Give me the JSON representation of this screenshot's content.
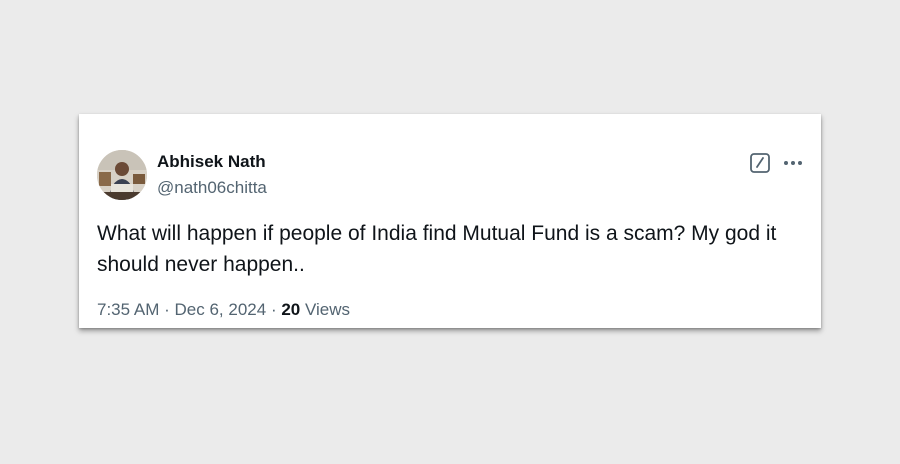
{
  "tweet": {
    "author": {
      "display_name": "Abhisek Nath",
      "handle": "@nath06chitta"
    },
    "text": "What will happen if people of India find Mutual Fund is a scam? My god it should never happen..",
    "meta": {
      "time": "7:35 AM",
      "separator": "·",
      "date": "Dec 6, 2024",
      "views_count": "20",
      "views_label": "Views"
    },
    "icons": {
      "edit": "edit-icon",
      "more": "more-options-icon",
      "avatar": "user-avatar"
    },
    "colors": {
      "text_primary": "#0f1419",
      "text_secondary": "#536471",
      "background": "#ebebeb",
      "card": "#ffffff"
    }
  }
}
